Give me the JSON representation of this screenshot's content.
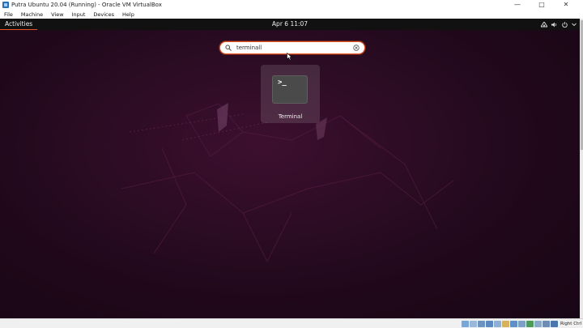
{
  "window": {
    "title": "Putra Ubuntu 20.04 (Running) - Oracle VM VirtualBox",
    "controls": [
      "—",
      "□",
      "✕"
    ]
  },
  "menubar": {
    "items": [
      "File",
      "Machine",
      "View",
      "Input",
      "Devices",
      "Help"
    ]
  },
  "gnome": {
    "activities_label": "Activities",
    "clock": "Apr 6  11:07",
    "tray_icons": [
      "network-icon",
      "volume-icon",
      "power-icon",
      "chevron-down-icon"
    ]
  },
  "search": {
    "value": "terminall",
    "icon": "search-icon",
    "clear_icon": "clear-icon"
  },
  "results": [
    {
      "label": "Terminal",
      "icon": "terminal-icon",
      "prompt": ">_"
    }
  ],
  "statusbar": {
    "host_key_label": "Right Ctrl",
    "icons": [
      "hdd-icon",
      "optical-icon",
      "audio-icon",
      "network-icon",
      "usb-icon",
      "shared-folder-icon",
      "display-icon",
      "recording-icon",
      "cpu-icon",
      "mouse-icon",
      "keyboard-icon",
      "host-key-icon"
    ]
  },
  "colors": {
    "accent": "#e95420",
    "topbar": "#111111",
    "background": "#2c0c24"
  }
}
